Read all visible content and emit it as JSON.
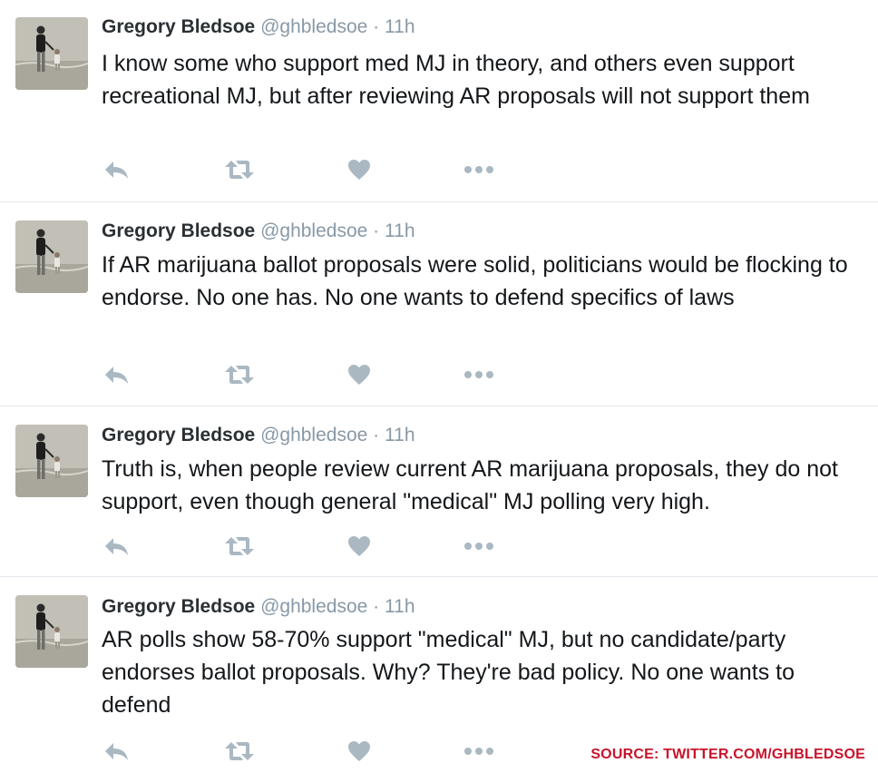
{
  "tweets": [
    {
      "name": "Gregory Bledsoe",
      "handle": "@ghbledsoe",
      "separator": "·",
      "time": "11h",
      "text": "I know some who support med MJ in theory, and others even support recreational MJ, but after reviewing AR proposals will not support them"
    },
    {
      "name": "Gregory Bledsoe",
      "handle": "@ghbledsoe",
      "separator": "·",
      "time": "11h",
      "text": "If AR marijuana ballot proposals were solid, politicians would be flocking to endorse. No one has. No one wants to defend specifics of laws"
    },
    {
      "name": "Gregory Bledsoe",
      "handle": "@ghbledsoe",
      "separator": "·",
      "time": "11h",
      "text": "Truth is, when people review current AR marijuana proposals, they do not support, even though general \"medical\" MJ polling very high."
    },
    {
      "name": "Gregory Bledsoe",
      "handle": "@ghbledsoe",
      "separator": "·",
      "time": "11h",
      "text": "AR polls show 58-70% support \"medical\" MJ, but no candidate/party endorses ballot proposals. Why? They're bad policy. No one wants to defend"
    }
  ],
  "icons": {
    "reply": "reply-icon",
    "retweet": "retweet-icon",
    "like": "heart-icon",
    "more": "more-icon"
  },
  "colors": {
    "name": "#292f33",
    "meta": "#8899a6",
    "text": "#14171a",
    "action_icon": "#aab8c2",
    "divider": "#e1e8ed",
    "source": "#c8142b"
  },
  "source_credit": "SOURCE: TWITTER.COM/GHBLEDSOE"
}
